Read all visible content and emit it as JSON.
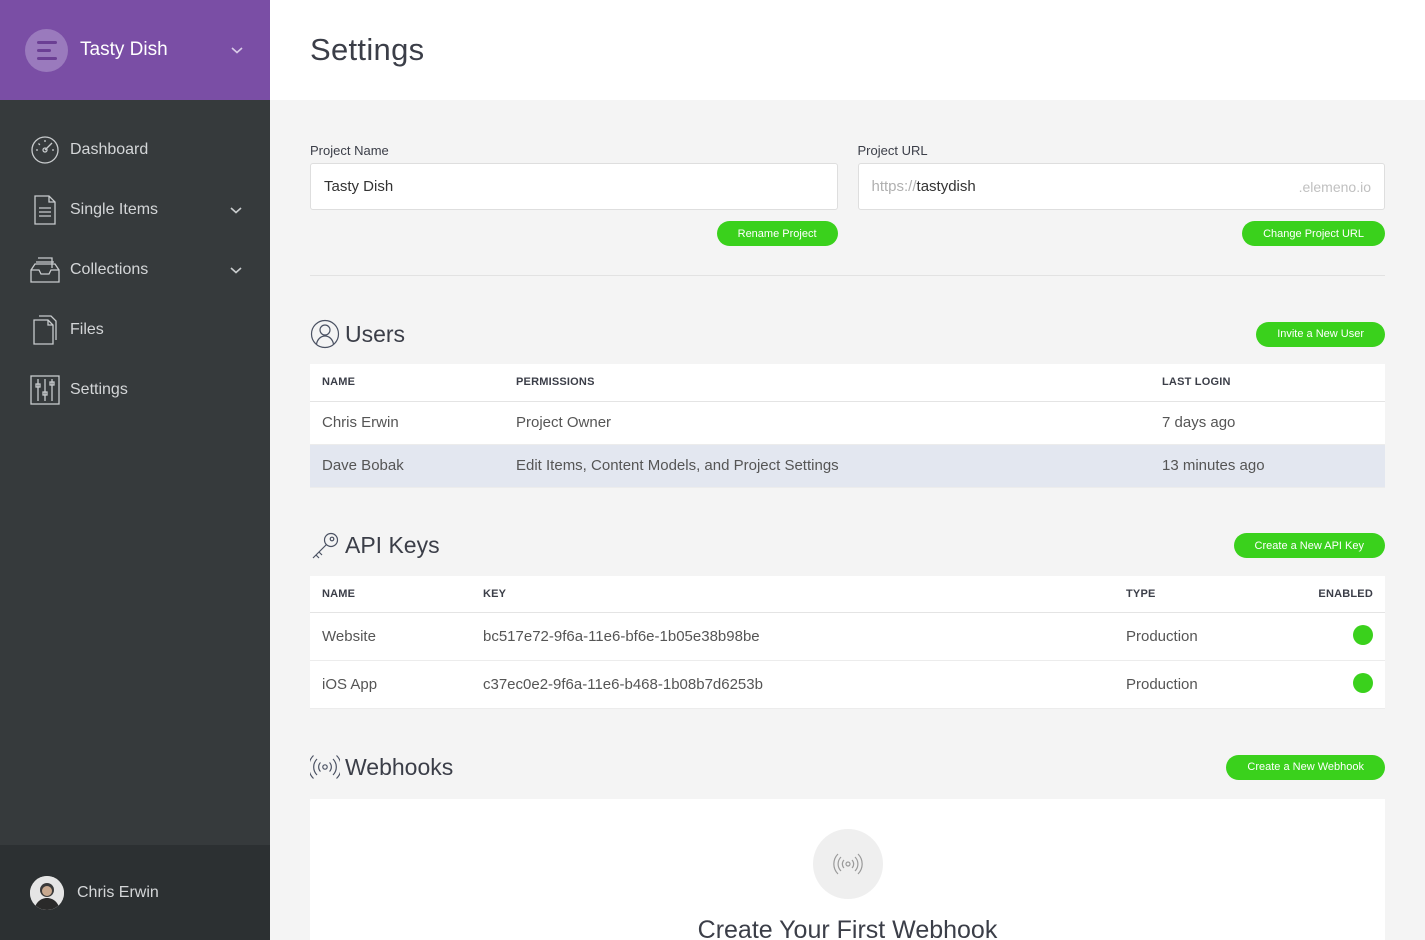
{
  "sidebar": {
    "project_name": "Tasty Dish",
    "nav": [
      {
        "label": "Dashboard",
        "icon": "gauge-icon"
      },
      {
        "label": "Single Items",
        "icon": "document-icon"
      },
      {
        "label": "Collections",
        "icon": "inbox-stack-icon"
      },
      {
        "label": "Files",
        "icon": "files-icon"
      },
      {
        "label": "Settings",
        "icon": "sliders-icon"
      }
    ],
    "user_name": "Chris Erwin"
  },
  "header": {
    "title": "Settings"
  },
  "project": {
    "name_label": "Project Name",
    "name_value": "Tasty Dish",
    "rename_button": "Rename Project",
    "url_label": "Project URL",
    "url_prefix": "https://",
    "url_value": "tastydish",
    "url_suffix": ".elemeno.io",
    "change_url_button": "Change Project URL"
  },
  "users": {
    "title": "Users",
    "invite_button": "Invite a New User",
    "columns": [
      "NAME",
      "PERMISSIONS",
      "LAST LOGIN"
    ],
    "rows": [
      {
        "name": "Chris Erwin",
        "permissions": "Project Owner",
        "last_login": "7 days ago"
      },
      {
        "name": "Dave Bobak",
        "permissions": "Edit Items, Content Models, and Project Settings",
        "last_login": "13 minutes ago"
      }
    ]
  },
  "api_keys": {
    "title": "API Keys",
    "create_button": "Create a New API Key",
    "columns": [
      "NAME",
      "KEY",
      "TYPE",
      "ENABLED"
    ],
    "rows": [
      {
        "name": "Website",
        "key": "bc517e72-9f6a-11e6-bf6e-1b05e38b98be",
        "type": "Production",
        "enabled": true
      },
      {
        "name": "iOS App",
        "key": "c37ec0e2-9f6a-11e6-b468-1b08b7d6253b",
        "type": "Production",
        "enabled": true
      }
    ]
  },
  "webhooks": {
    "title": "Webhooks",
    "create_button": "Create a New Webhook",
    "empty_title": "Create Your First Webhook"
  },
  "colors": {
    "brand_purple": "#7a4ea5",
    "sidebar_bg": "#363a3c",
    "accent_green": "#3ad11c",
    "selected_row": "#e3e7f0"
  }
}
